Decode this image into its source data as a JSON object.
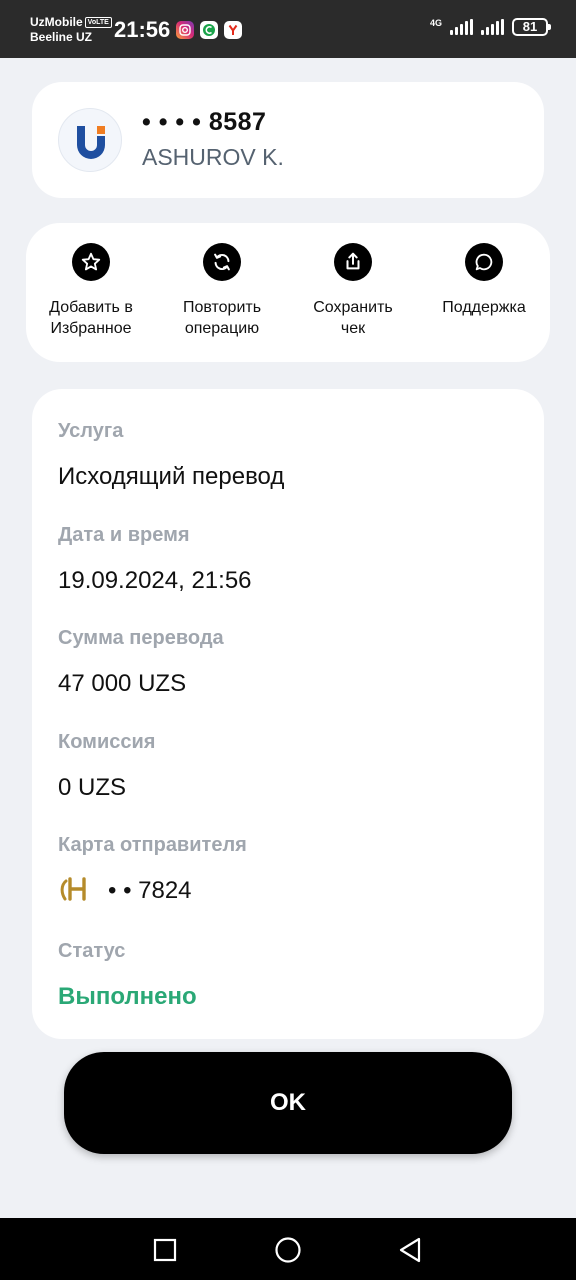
{
  "status_bar": {
    "carrier_primary": "UzMobile",
    "volte": "VoLTE",
    "carrier_secondary": "Beeline UZ",
    "time": "21:56",
    "network": "4G",
    "battery": "81",
    "app_icons": [
      "instagram-icon",
      "messenger-icon",
      "yandex-icon"
    ]
  },
  "recipient": {
    "card_mask": "• • • •",
    "card_last4": "8587",
    "name": "ASHUROV K."
  },
  "actions": [
    {
      "label_line1": "Добавить в",
      "label_line2": "Избранное",
      "icon": "star-icon"
    },
    {
      "label_line1": "Повторить",
      "label_line2": "операцию",
      "icon": "refresh-icon"
    },
    {
      "label_line1": "Сохранить",
      "label_line2": "чек",
      "icon": "share-icon"
    },
    {
      "label_line1": "Поддержка",
      "label_line2": "",
      "icon": "chat-icon"
    }
  ],
  "details": {
    "service_label": "Услуга",
    "service_value": "Исходящий перевод",
    "datetime_label": "Дата и время",
    "datetime_value": "19.09.2024, 21:56",
    "amount_label": "Сумма перевода",
    "amount_value": "47 000 UZS",
    "fee_label": "Комиссия",
    "fee_value": "0 UZS",
    "sender_label": "Карта отправителя",
    "sender_value": "• • 7824",
    "status_label": "Статус",
    "status_value": "Выполнено"
  },
  "ok_button": "OK",
  "colors": {
    "background": "#eff1f5",
    "status_success": "#2aa876",
    "label_gray": "#a0a6ae",
    "bank_logo_blue": "#1f4fa0",
    "bank_logo_orange": "#f07d22",
    "sender_logo_gold": "#b58b2a"
  }
}
